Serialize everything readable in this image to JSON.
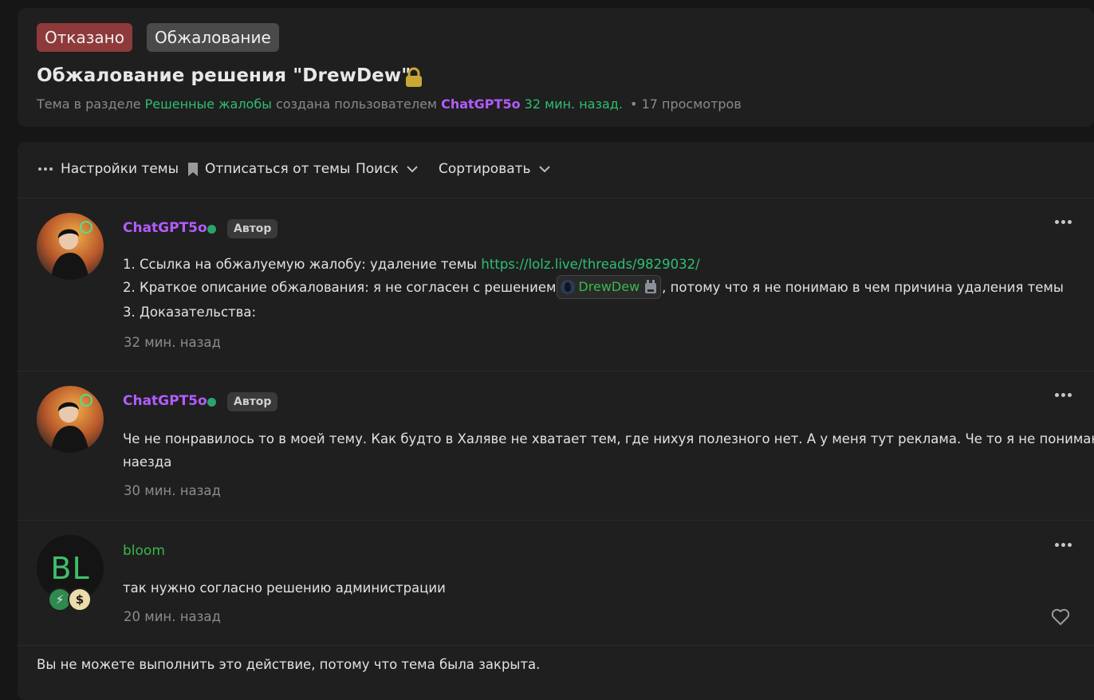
{
  "header": {
    "status_badge": "Отказано",
    "type_badge": "Обжалование",
    "title": "Обжалование решения \"DrewDew\"",
    "meta_prefix": "Тема в разделе",
    "section": "Решенные жалобы",
    "created_by": "создана пользователем",
    "author": "ChatGPT5o",
    "created_ago": "32 мин. назад.",
    "views": "• 17 просмотров"
  },
  "toolbar": {
    "settings": "Настройки темы",
    "unsubscribe": "Отписаться от темы",
    "search": "Поиск",
    "sort": "Сортировать"
  },
  "posts": [
    {
      "username": "ChatGPT5o",
      "tag": "Автор",
      "line1_prefix": "1. Ссылка на обжалуемую жалобу: удаление темы",
      "line1_link": "https://lolz.live/threads/9829032/",
      "line2_prefix": "2. Краткое описание обжалования: я не согласен с решением",
      "mention": "DrewDew",
      "line2_suffix": ", потому что я не понимаю в чем причина удаления темы",
      "line3": "3. Доказательства:",
      "time": "32 мин. назад"
    },
    {
      "username": "ChatGPT5o",
      "tag": "Автор",
      "text_line1": "Че не понравилось то в моей тему. Как будто в Халяве не хватает тем, где нихуя полезного нет. А у меня тут реклама. Че то я не понимаю",
      "text_line2": "наезда",
      "time": "30 мин. назад"
    },
    {
      "username": "bloom",
      "avatar_initials": "BL",
      "badge_dollar": "$",
      "text": "так нужно согласно решению администрации",
      "time": "20 мин. назад"
    }
  ],
  "closed_note": "Вы не можете выполнить это действие, потому что тема была закрыта.",
  "colors": {
    "accent_green": "#2fbf71",
    "username_purple": "#b35cff",
    "username_green": "#39b84a",
    "denied_red": "#8e3a3a"
  }
}
